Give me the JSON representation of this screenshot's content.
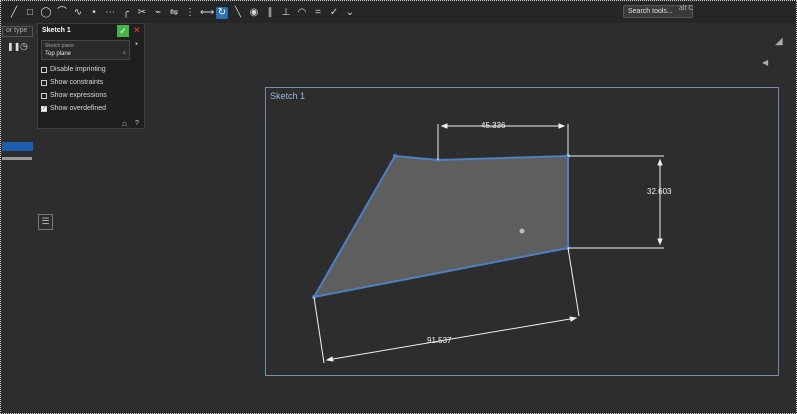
{
  "toolbar": {
    "icons": [
      "line-icon",
      "rectangle-icon",
      "circle-icon",
      "arc-icon",
      "spline-icon",
      "point-icon",
      "construction-icon",
      "fillet-icon",
      "trim-icon",
      "offset-icon",
      "mirror-icon",
      "pattern-icon",
      "dimension-icon",
      "snap-icon",
      "constraint-icon",
      "midpoint-icon",
      "parallel-icon",
      "perpendicular-icon",
      "tangent-icon",
      "equal-icon",
      "fix-icon",
      "chevron-icon"
    ],
    "search_placeholder": "Search tools...",
    "search_keys": "alt C"
  },
  "left_panel": {
    "input_placeholder": "or type",
    "buttons": [
      "pause-icon",
      "clock-icon"
    ]
  },
  "sketch_panel": {
    "title": "Sketch 1",
    "plane_label": "Sketch plane",
    "plane_value": "Top plane",
    "plane_clear": "×",
    "options": [
      {
        "label": "Disable imprinting",
        "checked": false
      },
      {
        "label": "Show constraints",
        "checked": false
      },
      {
        "label": "Show expressions",
        "checked": false
      },
      {
        "label": "Show overdefined",
        "checked": true
      }
    ]
  },
  "sketch": {
    "title": "Sketch 1",
    "dimensions": {
      "top": "45.336",
      "right": "32.603",
      "bottom": "91.537"
    }
  }
}
